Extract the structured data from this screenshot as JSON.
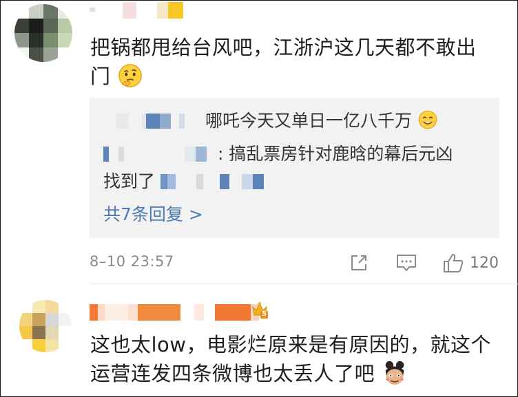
{
  "comments": [
    {
      "text_line1": "把锅都甩给台风吧，江浙沪这几天都不敢出",
      "text_line2": "门",
      "emoji": "thinking-emoji",
      "replies": [
        {
          "text": "哪吒今天又单日一亿八千万",
          "emoji": "smile-emoji"
        },
        {
          "text_line1": ": 搞乱票房针对鹿晗的幕后元凶",
          "text_line2": "找到了"
        }
      ],
      "more_replies_label": "共7条回复 >",
      "timestamp": "8–10 23:57",
      "like_count": "120",
      "icons": [
        "share-icon",
        "comment-icon",
        "like-icon"
      ]
    },
    {
      "badge_text": "5",
      "text_line1": "这也太low，电影烂原来是有原因的，就这个",
      "text_line2": "运营连发四条微博也太丢人了吧",
      "emoji": "nezha-emoji"
    }
  ],
  "colors": {
    "link": "#4f7db3",
    "reply_bg": "#f2f2f2",
    "meta_text": "#8a8a8a",
    "name_orange": "#f08a3c",
    "badge_gold": "#f2b01e"
  }
}
